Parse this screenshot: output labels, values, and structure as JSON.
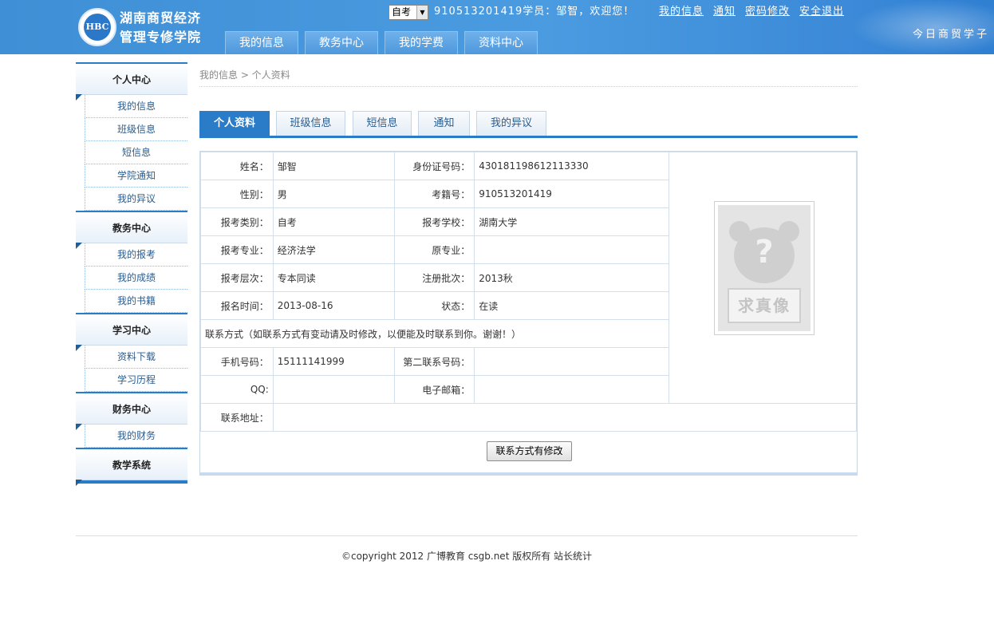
{
  "header": {
    "logo_text": "HBC",
    "school_name_line1": "湖南商贸经济",
    "school_name_line2": "管理专修学院",
    "exam_select": "自考",
    "welcome": "910513201419学员：邹智，欢迎您！",
    "links": [
      "我的信息",
      "通知",
      "密码修改",
      "安全退出"
    ],
    "slogan": "今日商贸学子",
    "nav": [
      "我的信息",
      "教务中心",
      "我的学费",
      "资料中心"
    ]
  },
  "sidebar": [
    {
      "title": "个人中心",
      "items": [
        "我的信息",
        "班级信息",
        "短信息",
        "学院通知",
        "我的异议"
      ]
    },
    {
      "title": "教务中心",
      "items": [
        "我的报考",
        "我的成绩",
        "我的书籍"
      ]
    },
    {
      "title": "学习中心",
      "items": [
        "资料下载",
        "学习历程"
      ]
    },
    {
      "title": "财务中心",
      "items": [
        "我的财务"
      ]
    },
    {
      "title": "教学系统",
      "items": []
    }
  ],
  "breadcrumb": "我的信息 > 个人资料",
  "tabs": [
    "个人资料",
    "班级信息",
    "短信息",
    "通知",
    "我的异议"
  ],
  "profile": {
    "name_label": "姓名：",
    "name": "邹智",
    "id_label": "身份证号码：",
    "id": "430181198612113330",
    "gender_label": "性别：",
    "gender": "男",
    "exam_no_label": "考籍号：",
    "exam_no": "910513201419",
    "category_label": "报考类别：",
    "category": "自考",
    "school_label": "报考学校：",
    "school": "湖南大学",
    "major_label": "报考专业：",
    "major": "经济法学",
    "orig_major_label": "原专业：",
    "orig_major": "",
    "level_label": "报考层次：",
    "level": "专本同读",
    "batch_label": "注册批次：",
    "batch": "2013秋",
    "date_label": "报名时间：",
    "date": "2013-08-16",
    "status_label": "状态：",
    "status": "在读",
    "contact_note": "联系方式（如联系方式有变动请及时修改，以便能及时联系到你。谢谢！）",
    "mobile_label": "手机号码：",
    "mobile": "15111141999",
    "phone2_label": "第二联系号码：",
    "phone2": "",
    "qq_label": "QQ:",
    "qq": "",
    "email_label": "电子邮箱：",
    "email": "",
    "address_label": "联系地址：",
    "address": "",
    "photo_text": "求真像",
    "edit_button": "联系方式有修改"
  },
  "footer": "©copyright 2012 广博教育 csgb.net 版权所有 站长统计"
}
